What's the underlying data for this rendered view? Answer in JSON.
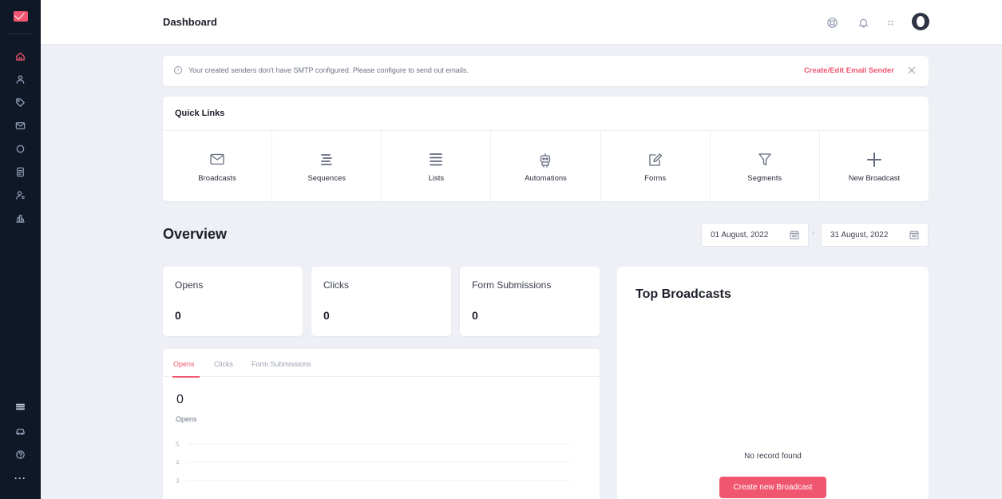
{
  "colors": {
    "accent": "#f0566f",
    "rail": "#0f1827",
    "page_bg": "#eef0f6"
  },
  "header": {
    "title": "Dashboard",
    "icons": [
      "lifebuoy-icon",
      "bell-icon",
      "apps-grid-icon",
      "avatar"
    ]
  },
  "rail": {
    "top_items": [
      "home-icon",
      "contacts-icon",
      "tag-icon",
      "email-icon",
      "sequences-icon",
      "forms-icon",
      "user-icon",
      "reports-icon"
    ],
    "bottom_items": [
      "flag-icon",
      "car-icon",
      "help-icon",
      "more-icon"
    ],
    "more_label": "···"
  },
  "notice": {
    "info_glyph": "i",
    "message": "Your created senders don't have SMTP configured. Please configure to send out emails.",
    "link": "Create/Edit Email Sender"
  },
  "quick_links": {
    "title": "Quick Links",
    "items": [
      {
        "label": "Broadcasts",
        "icon": "envelope-icon"
      },
      {
        "label": "Sequences",
        "icon": "sequences-icon"
      },
      {
        "label": "Lists",
        "icon": "list-icon"
      },
      {
        "label": "Automations",
        "icon": "robot-icon"
      },
      {
        "label": "Forms",
        "icon": "edit-form-icon"
      },
      {
        "label": "Segments",
        "icon": "filter-icon"
      },
      {
        "label": "New Broadcast",
        "icon": "plus-icon"
      }
    ]
  },
  "overview": {
    "title": "Overview",
    "date_from": "01 August, 2022",
    "date_to": "31 August, 2022",
    "date_separator": "-",
    "stats": [
      {
        "name": "Opens",
        "value": "0"
      },
      {
        "name": "Clicks",
        "value": "0"
      },
      {
        "name": "Form Submissions",
        "value": "0"
      }
    ]
  },
  "chart_panel": {
    "tabs": [
      "Opens",
      "Clicks",
      "Form Submissions"
    ],
    "active_tab": "Opens",
    "value": "0",
    "value_label": "Opens"
  },
  "chart_data": {
    "type": "line",
    "series": [],
    "y_ticks": [
      "5",
      "4",
      "3"
    ],
    "ylim": [
      0,
      5
    ],
    "grid": true
  },
  "top_broadcasts": {
    "title": "Top Broadcasts",
    "empty_text": "No record found",
    "button": "Create new Broadcast"
  }
}
